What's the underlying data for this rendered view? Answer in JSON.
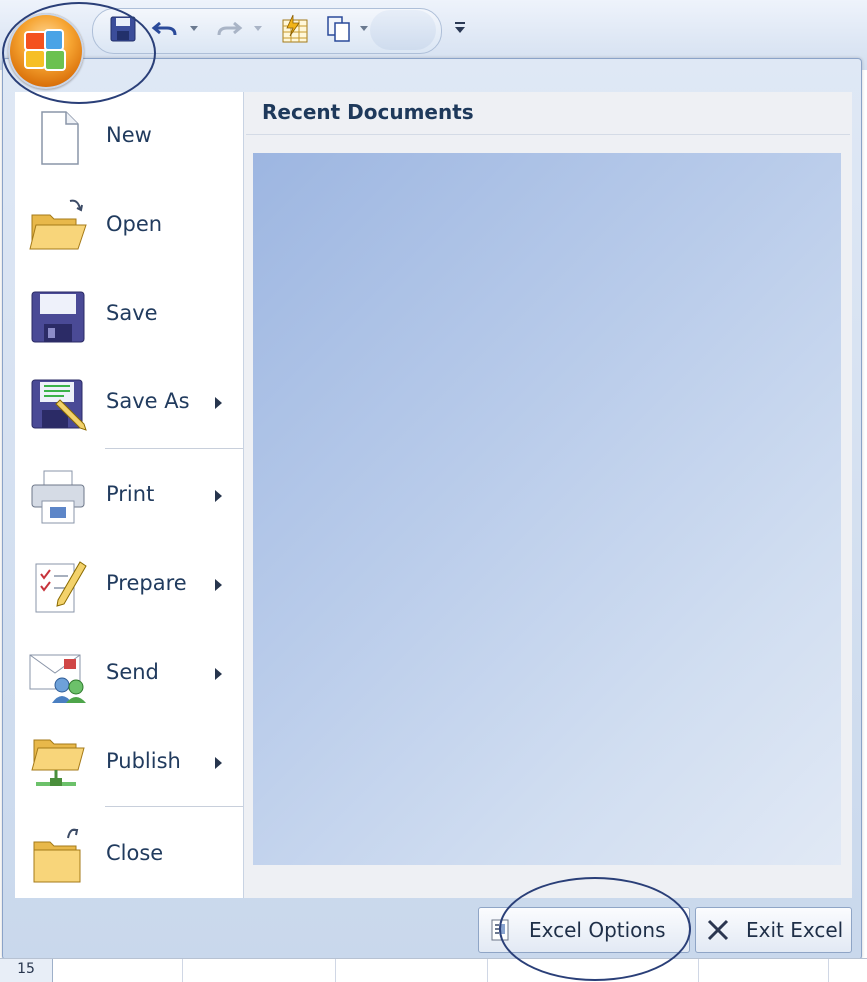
{
  "quick_access_toolbar": {
    "icons": [
      "save-icon",
      "undo-icon",
      "redo-icon",
      "calculator-icon",
      "copy-icon",
      "customize-icon"
    ]
  },
  "office_button": {
    "icon": "office-logo-icon"
  },
  "menu": {
    "items": [
      {
        "label": "New",
        "icon": "new-document-icon",
        "has_submenu": false
      },
      {
        "label": "Open",
        "icon": "open-folder-icon",
        "has_submenu": false
      },
      {
        "label": "Save",
        "icon": "floppy-disk-icon",
        "has_submenu": false
      },
      {
        "label": "Save As",
        "icon": "save-as-icon",
        "has_submenu": true
      },
      {
        "label": "Print",
        "icon": "printer-icon",
        "has_submenu": true
      },
      {
        "label": "Prepare",
        "icon": "prepare-document-icon",
        "has_submenu": true
      },
      {
        "label": "Send",
        "icon": "send-icon",
        "has_submenu": true
      },
      {
        "label": "Publish",
        "icon": "publish-folder-icon",
        "has_submenu": true
      },
      {
        "label": "Close",
        "icon": "close-folder-icon",
        "has_submenu": false
      }
    ]
  },
  "recent_documents": {
    "title": "Recent Documents"
  },
  "bottom_buttons": {
    "options_label": "Excel Options",
    "exit_label": "Exit Excel"
  },
  "sheet": {
    "row_number": "15"
  },
  "colors": {
    "accent": "#1e395b",
    "office_orange": "#f6a431",
    "annotation": "#2a3f78"
  }
}
